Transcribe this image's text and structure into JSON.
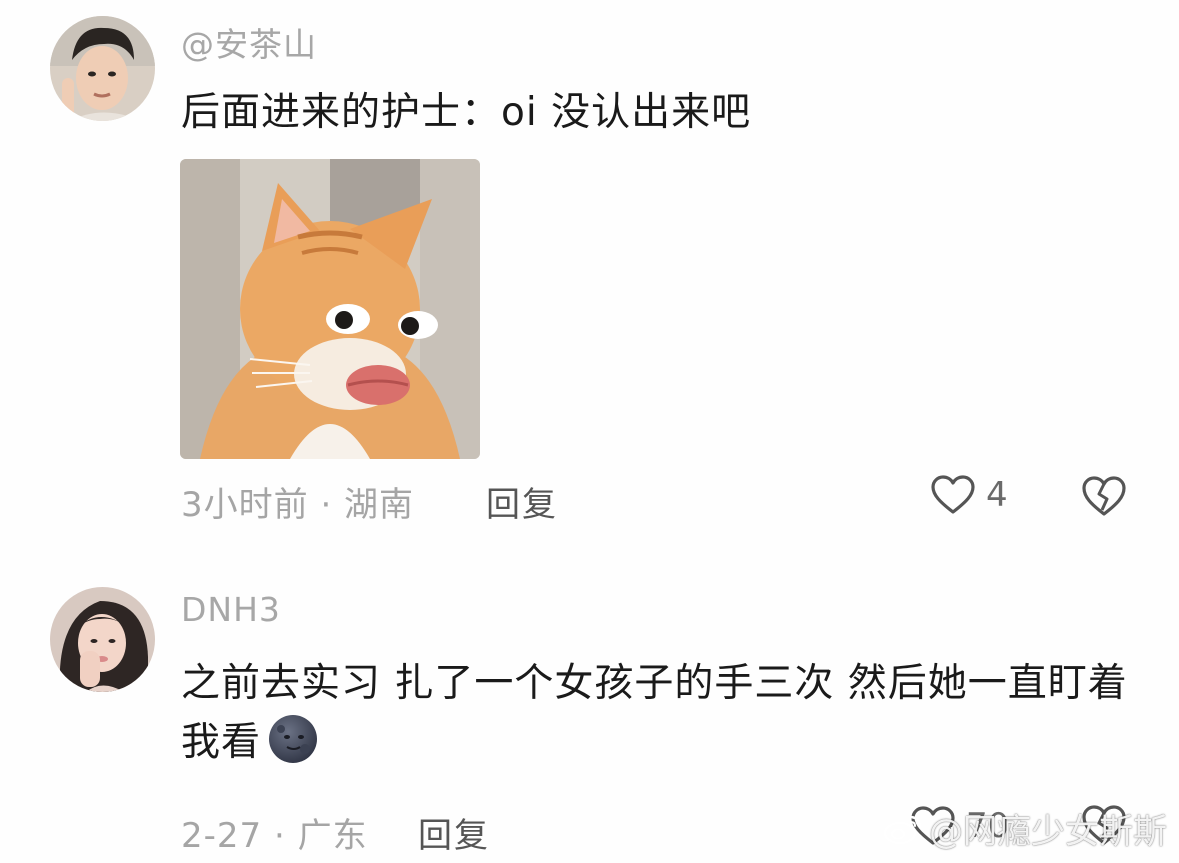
{
  "comments": [
    {
      "username": "@安茶山",
      "text": "后面进来的护士：oi 没认出来吧",
      "meta": "3小时前 · 湖南",
      "reply_label": "回复",
      "like_count": "4",
      "image": "cat-meme"
    },
    {
      "username": "DNH3",
      "text": "之前去实习 扎了一个女孩子的手三次 然后她一直盯着我看",
      "emoji": "new-moon-face",
      "meta": "2-27 · 广东",
      "reply_label": "回复",
      "like_count": "70"
    }
  ],
  "watermark": {
    "text": "@网瘾少女斯斯",
    "icon": "weibo-logo-icon"
  },
  "colors": {
    "background": "#fefefe",
    "text": "#1a1a1a",
    "muted": "#a7a7a7"
  }
}
